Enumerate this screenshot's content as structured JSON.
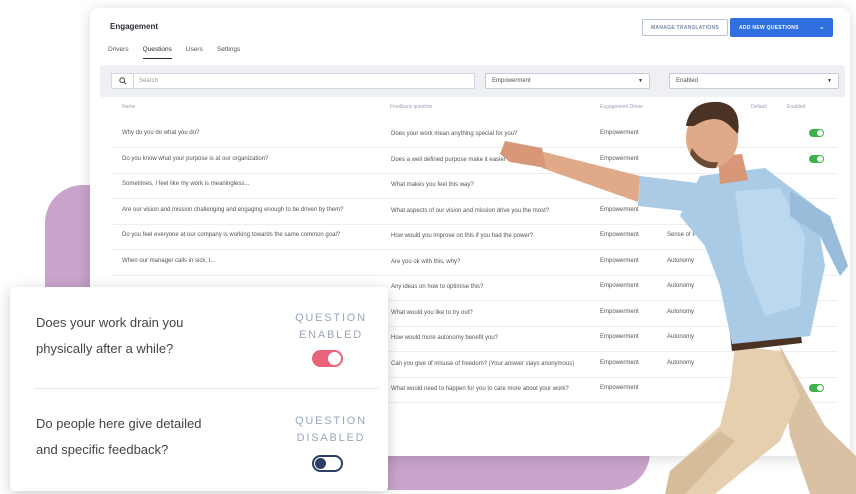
{
  "header": {
    "title": "Engagement",
    "manage_translations": "MANAGE TRANSLATIONS",
    "add_new_questions": "ADD NEW QUESTIONS",
    "add_chevron": "⌄"
  },
  "tabs": [
    {
      "label": "Drivers",
      "active": false
    },
    {
      "label": "Questions",
      "active": true
    },
    {
      "label": "Users",
      "active": false
    },
    {
      "label": "Settings",
      "active": false
    }
  ],
  "filters": {
    "search_placeholder": "Search",
    "driver_value": "Empowerment",
    "status_value": "Enabled"
  },
  "table": {
    "columns": {
      "name": "Name",
      "feedback": "Feedback question",
      "driver": "Engagement Driver",
      "default": "Default",
      "enabled": "Enabled"
    },
    "rows": [
      {
        "name": "Why do you do what you do?",
        "feedback": "Does your work mean anything special for you?",
        "driver": "Empowerment",
        "sub": "",
        "default_icon": false,
        "enabled": true
      },
      {
        "name": "Do you know what your purpose is at our organization?",
        "feedback": "Does a well defined purpose make it easier for you to do ... in?",
        "driver": "Empowerment",
        "sub": "",
        "default_icon": false,
        "enabled": true
      },
      {
        "name": "Sometimes, I feel like my work is meaningless...",
        "feedback": "What makes you feel this way?",
        "driver": "",
        "sub": "",
        "default_icon": false,
        "enabled": false
      },
      {
        "name": "Are our vision and mission challenging and engaging enough to be driven by them?",
        "feedback": "What aspects of our vision and mission drive you the most?",
        "driver": "Empowerment",
        "sub": "",
        "default_icon": false,
        "enabled": false
      },
      {
        "name": "Do you feel everyone at our company is working towards the same common goal?",
        "feedback": "How would you improve on this if you had the power?",
        "driver": "Empowerment",
        "sub": "Sense of Purpose",
        "default_icon": false,
        "enabled": false
      },
      {
        "name": "When our manager calls in sick, I...",
        "feedback": "Are you ok with this, why?",
        "driver": "Empowerment",
        "sub": "Autonomy",
        "default_icon": false,
        "enabled": false
      },
      {
        "name": "",
        "feedback": "Any ideas on how to optimise this?",
        "driver": "Empowerment",
        "sub": "Autonomy",
        "default_icon": true,
        "enabled": false
      },
      {
        "name": "",
        "feedback": "What would you like to try out?",
        "driver": "Empowerment",
        "sub": "Autonomy",
        "default_icon": true,
        "enabled": false
      },
      {
        "name": "",
        "feedback": "How would more autonomy benefit you?",
        "driver": "Empowerment",
        "sub": "Autonomy",
        "default_icon": true,
        "enabled": false
      },
      {
        "name": "",
        "feedback": "Can you give of misuse of freedom? (Your answer stays anonymous)",
        "driver": "Empowerment",
        "sub": "Autonomy",
        "default_icon": true,
        "enabled": false
      },
      {
        "name": "",
        "feedback": "What would need to happen for you to care more about your work?",
        "driver": "Empowerment",
        "sub": "",
        "default_icon": false,
        "enabled": true
      }
    ]
  },
  "overlay": {
    "q1": {
      "line1": "Does your work drain you",
      "line2": "physically after a while?",
      "status1": "QUESTION",
      "status2": "ENABLED",
      "enabled": true
    },
    "q2": {
      "line1": "Do people here give detailed",
      "line2": "and specific feedback?",
      "status1": "QUESTION",
      "status2": "DISABLED",
      "enabled": false
    }
  },
  "colors": {
    "accent": "#2f6fe0",
    "enabled_green": "#3ab34a",
    "toggle_pink": "#e96379",
    "blob_purple": "#c9a4cc"
  }
}
